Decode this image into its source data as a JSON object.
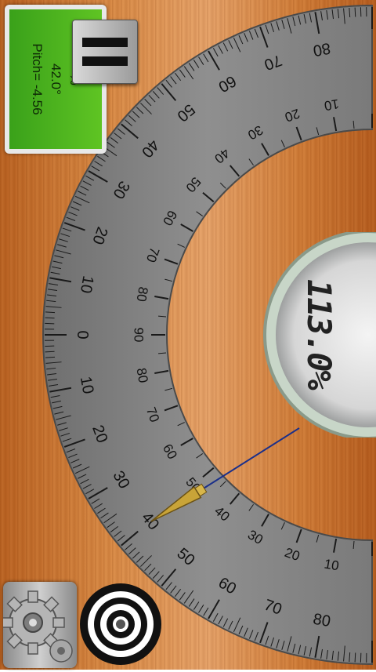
{
  "info": {
    "value_percent_suffix": "%",
    "angle": "42.0°",
    "pitch": "Pitch= -4.56"
  },
  "readout": {
    "value": "113.0%"
  },
  "dial": {
    "outer_labels": [
      "80",
      "70",
      "60",
      "50",
      "40",
      "30",
      "20",
      "10",
      "0",
      "10",
      "20",
      "30",
      "40",
      "50",
      "60",
      "70",
      "80"
    ],
    "inner_labels": [
      "10",
      "20",
      "30",
      "40",
      "50",
      "60",
      "70",
      "80",
      "90",
      "80",
      "70",
      "60",
      "50",
      "40",
      "30",
      "20",
      "10"
    ]
  },
  "pendulum": {
    "angle_deg": 42.0
  },
  "controls": {
    "pause_icon": "pause-icon",
    "settings_icon": "gear-icon",
    "calibrate_icon": "target-icon"
  }
}
